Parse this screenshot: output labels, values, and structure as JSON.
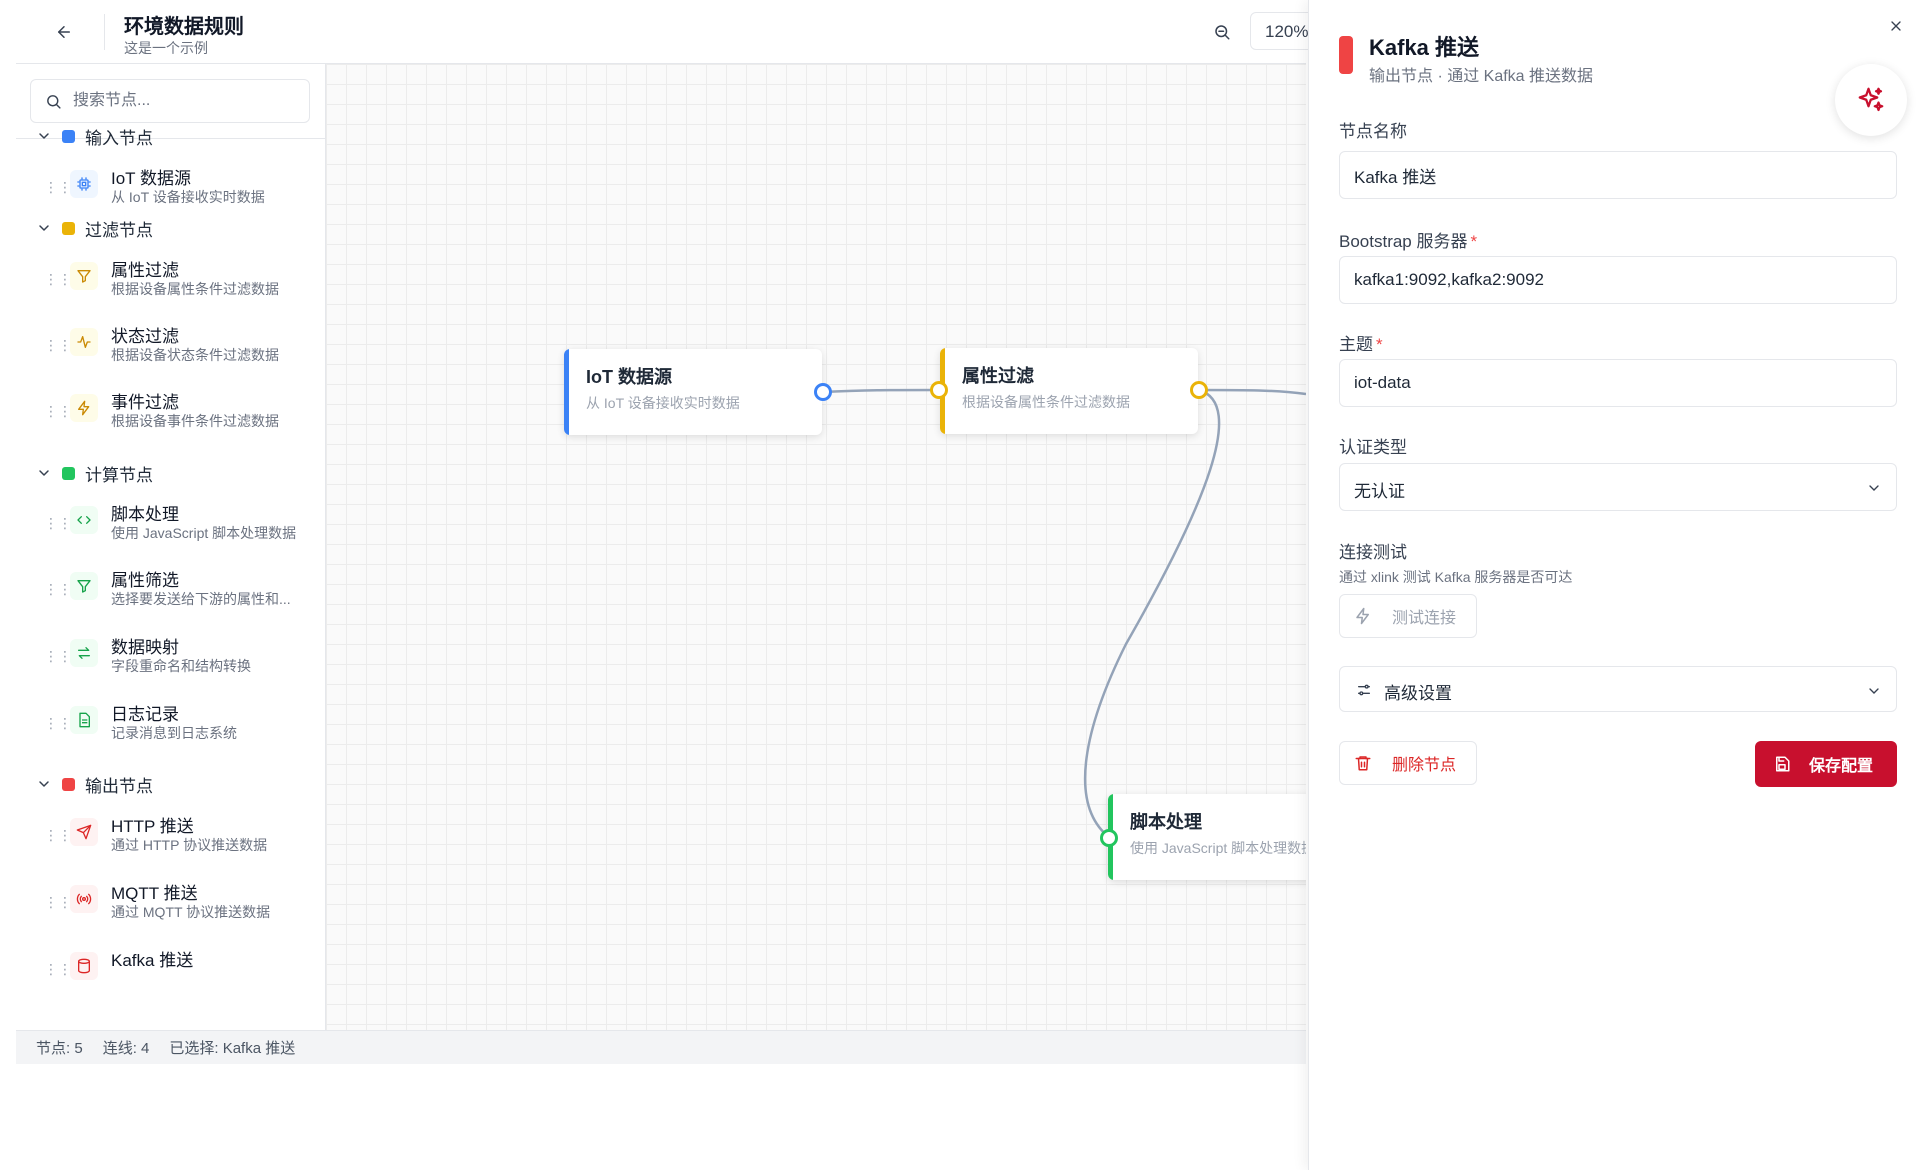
{
  "header": {
    "title": "环境数据规则",
    "subtitle": "这是一个示例",
    "zoom": "120%"
  },
  "sidebar": {
    "search_placeholder": "搜索节点...",
    "groups": [
      {
        "label": "输入节点",
        "color": "#3b82f6",
        "items": [
          {
            "name": "IoT 数据源",
            "desc": "从 IoT 设备接收实时数据",
            "icon": "chip-icon"
          }
        ]
      },
      {
        "label": "过滤节点",
        "color": "#eab308",
        "items": [
          {
            "name": "属性过滤",
            "desc": "根据设备属性条件过滤数据",
            "icon": "filter-icon"
          },
          {
            "name": "状态过滤",
            "desc": "根据设备状态条件过滤数据",
            "icon": "activity-icon"
          },
          {
            "name": "事件过滤",
            "desc": "根据设备事件条件过滤数据",
            "icon": "lightning-icon"
          }
        ]
      },
      {
        "label": "计算节点",
        "color": "#22c55e",
        "items": [
          {
            "name": "脚本处理",
            "desc": "使用 JavaScript 脚本处理数据",
            "icon": "code-icon"
          },
          {
            "name": "属性筛选",
            "desc": "选择要发送给下游的属性和...",
            "icon": "filter-icon"
          },
          {
            "name": "数据映射",
            "desc": "字段重命名和结构转换",
            "icon": "swap-icon"
          },
          {
            "name": "日志记录",
            "desc": "记录消息到日志系统",
            "icon": "document-icon"
          }
        ]
      },
      {
        "label": "输出节点",
        "color": "#ef4444",
        "items": [
          {
            "name": "HTTP 推送",
            "desc": "通过 HTTP 协议推送数据",
            "icon": "send-icon"
          },
          {
            "name": "MQTT 推送",
            "desc": "通过 MQTT 协议推送数据",
            "icon": "broadcast-icon"
          },
          {
            "name": "Kafka 推送",
            "desc": "",
            "icon": "database-icon"
          }
        ]
      }
    ]
  },
  "canvas": {
    "nodes": [
      {
        "id": "iot",
        "title": "IoT 数据源",
        "desc": "从 IoT 设备接收实时数据",
        "color": "#3b82f6"
      },
      {
        "id": "filter",
        "title": "属性过滤",
        "desc": "根据设备属性条件过滤数据",
        "color": "#eab308"
      },
      {
        "id": "script",
        "title": "脚本处理",
        "desc": "使用 JavaScript 脚本处理数据",
        "color": "#22c55e"
      }
    ]
  },
  "status": {
    "nodes": "节点: 5",
    "edges": "连线: 4",
    "selected": "已选择: Kafka 推送"
  },
  "panel": {
    "title": "Kafka 推送",
    "subtitle": "输出节点 · 通过 Kafka 推送数据",
    "accent_color": "#ef4444",
    "fields": {
      "node_name_label": "节点名称",
      "node_name_value": "Kafka 推送",
      "bootstrap_label": "Bootstrap 服务器",
      "bootstrap_value": "kafka1:9092,kafka2:9092",
      "topic_label": "主题",
      "topic_value": "iot-data",
      "auth_label": "认证类型",
      "auth_value": "无认证",
      "test_label": "连接测试",
      "test_help": "通过 xlink 测试 Kafka 服务器是否可达",
      "test_button": "测试连接",
      "advanced_label": "高级设置",
      "delete_button": "删除节点",
      "save_button": "保存配置",
      "required_mark": "*"
    }
  }
}
